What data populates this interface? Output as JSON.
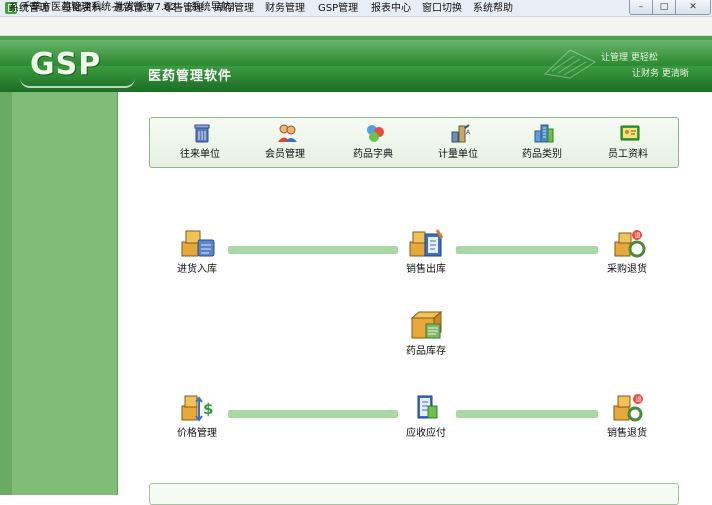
{
  "window": {
    "title": "千草方医药管理系统-批发版 V7.62 - [系统导航]",
    "minimize_glyph": "–",
    "maximize_glyph": "□",
    "close_glyph": "✕"
  },
  "menu": [
    "系统管理",
    "基础资料",
    "进销管理",
    "零售管理",
    "库存管理",
    "财务管理",
    "GSP管理",
    "报表中心",
    "窗口切换",
    "系统帮助"
  ],
  "header": {
    "logo": "GSP",
    "subtitle": "医药管理软件",
    "user_line1": "让管理 更轻松",
    "user_line2": "让财务 更清晰"
  },
  "toolbar": [
    {
      "label": "往来单位",
      "icon": "trash-bin-icon"
    },
    {
      "label": "会员管理",
      "icon": "users-icon"
    },
    {
      "label": "药品字典",
      "icon": "molecule-icon"
    },
    {
      "label": "计量单位",
      "icon": "measure-icon"
    },
    {
      "label": "药品类别",
      "icon": "buildings-icon"
    },
    {
      "label": "员工资料",
      "icon": "staff-card-icon"
    }
  ],
  "flow": {
    "purchase_in": "进货入库",
    "sales_out": "销售出库",
    "purchase_return": "采购退货",
    "drug_stock": "药品库存",
    "price_manage": "价格管理",
    "receivable_payable": "应收应付",
    "sales_return": "销售退货"
  },
  "colors": {
    "header_green": "#2d8a34",
    "sidebar_green": "#81bd78",
    "flow_line": "#a8d8a4"
  }
}
